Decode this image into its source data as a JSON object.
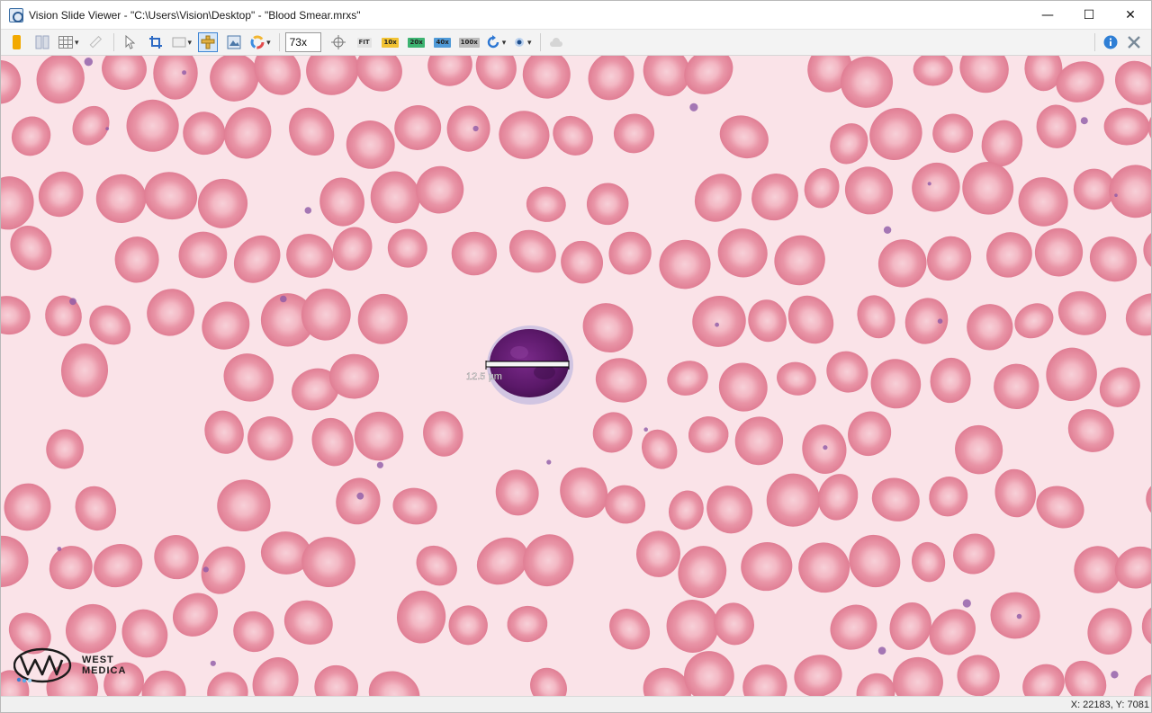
{
  "window": {
    "title": "Vision Slide Viewer - \"C:\\Users\\Vision\\Desktop\" - \"Blood Smear.mrxs\"",
    "controls": {
      "minimize": "—",
      "maximize": "☐",
      "close": "✕"
    }
  },
  "toolbar": {
    "zoom_value": "73x",
    "fit_label": "FIT",
    "presets": [
      "10x",
      "20x",
      "40x",
      "100x"
    ],
    "preset_colors": [
      "#f1c232",
      "#3cb371",
      "#4f9ad8",
      "#bbbbbb"
    ]
  },
  "viewer": {
    "measurement_label": "12.5 µm",
    "logo": {
      "line1": "WEST",
      "line2": "MEDICA"
    }
  },
  "status": {
    "coords": "X: 22183, Y: 7081"
  },
  "colors": {
    "background": "#f9dfe4",
    "rbc": "#e88ea0",
    "rbc_center": "#f6c8d1",
    "lymphocyte_nucleus": "#5a1a6b",
    "platelet": "#8e5aa6"
  }
}
